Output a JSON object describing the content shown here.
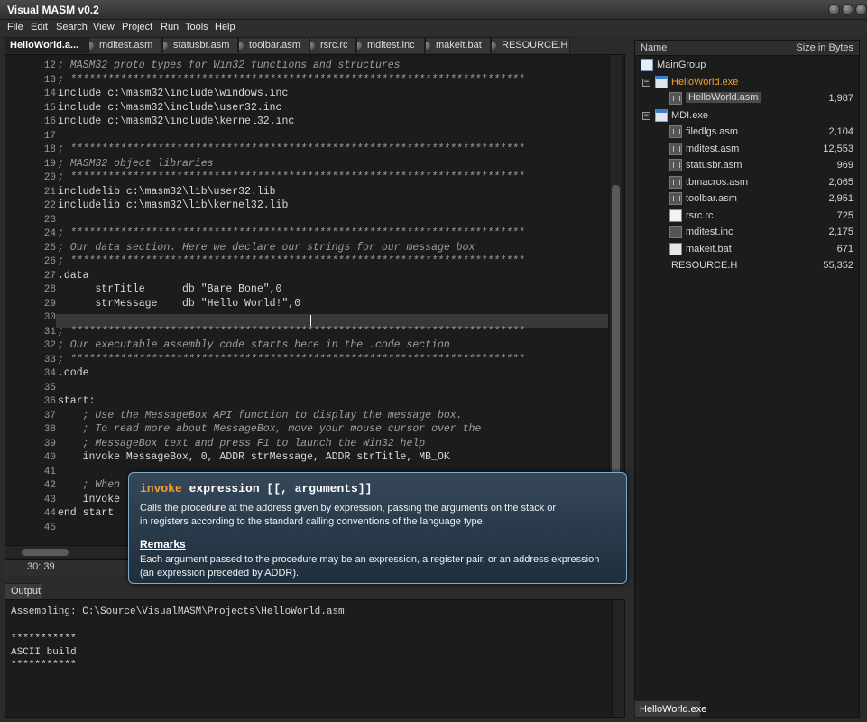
{
  "app": {
    "title": "Visual MASM v0.2"
  },
  "menu": [
    "File",
    "Edit",
    "Search",
    "View",
    "Project",
    "Run",
    "Tools",
    "Help"
  ],
  "tabs": [
    "HelloWorld.a...",
    "mditest.asm",
    "statusbr.asm",
    "toolbar.asm",
    "rsrc.rc",
    "mditest.inc",
    "makeit.bat",
    "RESOURCE.H"
  ],
  "editor": {
    "lines": [
      {
        "n": "12",
        "text": "; MASM32 proto types for Win32 functions and structures"
      },
      {
        "n": "13",
        "text": "; *************************************************************************"
      },
      {
        "n": "14",
        "text": "include c:\\masm32\\include\\windows.inc"
      },
      {
        "n": "15",
        "text": "include c:\\masm32\\include\\user32.inc"
      },
      {
        "n": "16",
        "text": "include c:\\masm32\\include\\kernel32.inc"
      },
      {
        "n": "17",
        "text": ""
      },
      {
        "n": "18",
        "text": "; *************************************************************************"
      },
      {
        "n": "19",
        "text": "; MASM32 object libraries"
      },
      {
        "n": "20",
        "text": "; *************************************************************************"
      },
      {
        "n": "21",
        "text": "includelib c:\\masm32\\lib\\user32.lib"
      },
      {
        "n": "22",
        "text": "includelib c:\\masm32\\lib\\kernel32.lib"
      },
      {
        "n": "23",
        "text": ""
      },
      {
        "n": "24",
        "text": "; *************************************************************************"
      },
      {
        "n": "25",
        "text": "; Our data section. Here we declare our strings for our message box"
      },
      {
        "n": "26",
        "text": "; *************************************************************************"
      },
      {
        "n": "27",
        "text": ".data"
      },
      {
        "n": "28",
        "text": "      strTitle      db \"Bare Bone\",0"
      },
      {
        "n": "29",
        "text": "      strMessage    db \"Hello World!\",0"
      },
      {
        "n": "30",
        "text": ""
      },
      {
        "n": "31",
        "text": "; *************************************************************************"
      },
      {
        "n": "32",
        "text": "; Our executable assembly code starts here in the .code section"
      },
      {
        "n": "33",
        "text": "; *************************************************************************"
      },
      {
        "n": "34",
        "text": ".code"
      },
      {
        "n": "35",
        "text": ""
      },
      {
        "n": "36",
        "text": "start:"
      },
      {
        "n": "37",
        "text": "    ; Use the MessageBox API function to display the message box."
      },
      {
        "n": "38",
        "text": "    ; To read more about MessageBox, move your mouse cursor over the"
      },
      {
        "n": "39",
        "text": "    ; MessageBox text and press F1 to launch the Win32 help"
      },
      {
        "n": "40",
        "text": "    invoke MessageBox, 0, ADDR strMessage, ADDR strTitle, MB_OK"
      },
      {
        "n": "41",
        "text": ""
      },
      {
        "n": "42",
        "text": "    ; When"
      },
      {
        "n": "43",
        "text": "    invoke"
      },
      {
        "n": "44",
        "text": "end start"
      },
      {
        "n": "45",
        "text": ""
      }
    ],
    "cursor_pos": "30: 39"
  },
  "tooltip": {
    "keyword": "invoke",
    "signature": " expression [[, arguments]]",
    "desc1": "Calls the procedure at the address given by expression, passing the arguments on the stack or",
    "desc2": "in registers according to the standard calling conventions of the language type.",
    "remarks_title": "Remarks",
    "remarks1": "Each argument passed to the procedure may be an expression, a register pair, or an address expression",
    "remarks2": "(an expression preceded by ADDR)."
  },
  "output": {
    "tab_label": "Output",
    "lines": [
      "Assembling: C:\\Source\\VisualMASM\\Projects\\HelloWorld.asm",
      "",
      "***********",
      "ASCII build",
      "***********"
    ]
  },
  "project_panel": {
    "col_name": "Name",
    "col_size": "Size in Bytes",
    "items": [
      {
        "label": "MainGroup",
        "size": "",
        "icon": "group-icon"
      },
      {
        "label": "HelloWorld.exe",
        "size": "",
        "icon": "exe-icon"
      },
      {
        "label": "HelloWorld.asm",
        "size": "1,987",
        "icon": "asm-file-icon"
      },
      {
        "label": "MDI.exe",
        "size": "",
        "icon": "exe-icon"
      },
      {
        "label": "filedlgs.asm",
        "size": "2,104",
        "icon": "asm-file-icon"
      },
      {
        "label": "mditest.asm",
        "size": "12,553",
        "icon": "asm-file-icon"
      },
      {
        "label": "statusbr.asm",
        "size": "969",
        "icon": "asm-file-icon"
      },
      {
        "label": "tbmacros.asm",
        "size": "2,065",
        "icon": "asm-file-icon"
      },
      {
        "label": "toolbar.asm",
        "size": "2,951",
        "icon": "asm-file-icon"
      },
      {
        "label": "rsrc.rc",
        "size": "725",
        "icon": "rc-file-icon"
      },
      {
        "label": "mditest.inc",
        "size": "2,175",
        "icon": "inc-file-icon"
      },
      {
        "label": "makeit.bat",
        "size": "671",
        "icon": "bat-file-icon"
      },
      {
        "label": "RESOURCE.H",
        "size": "55,352",
        "icon": "header-file-icon"
      }
    ],
    "bottom_tab": "HelloWorld.exe"
  },
  "colors": {
    "active_project": "#f0a030",
    "keyword": "#f0a030",
    "label": "#5aa0ff",
    "tooltip_border": "#7ea9c8"
  }
}
